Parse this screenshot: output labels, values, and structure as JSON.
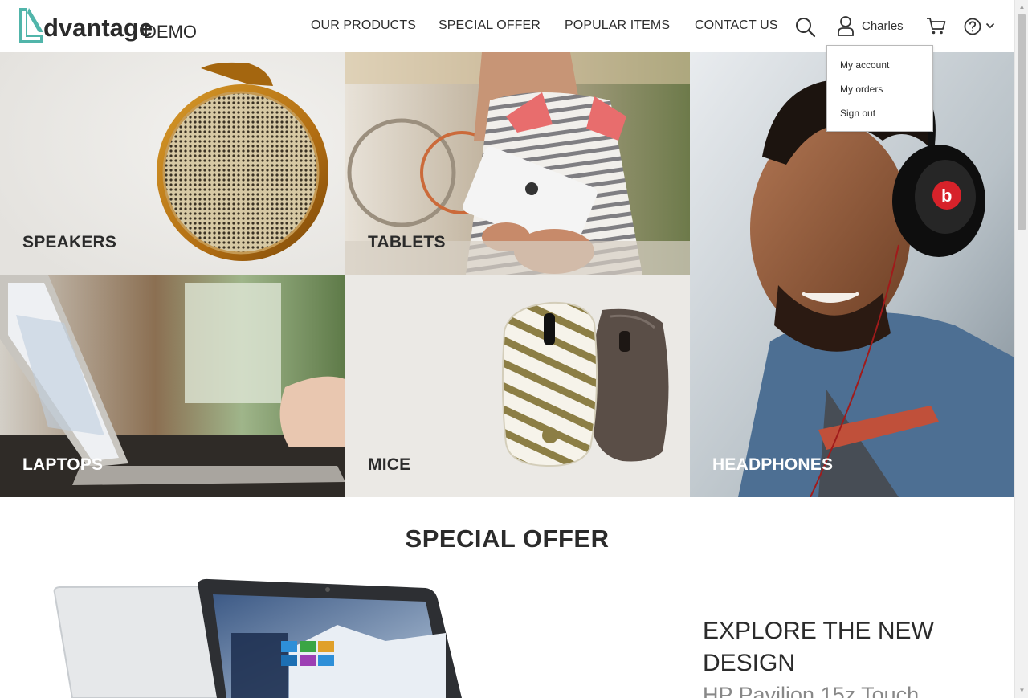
{
  "brand": {
    "name": "dvantage",
    "suffix": "DEMO"
  },
  "colors": {
    "accent": "#51b5aa",
    "text": "#2b2b2b"
  },
  "nav": {
    "items": [
      "OUR PRODUCTS",
      "SPECIAL OFFER",
      "POPULAR ITEMS",
      "CONTACT US"
    ]
  },
  "header": {
    "search_icon": "search-icon",
    "user_icon": "user-icon",
    "user_name": "Charles",
    "cart_icon": "cart-icon",
    "help_icon": "help-icon"
  },
  "user_menu": {
    "items": [
      "My account",
      "My orders",
      "Sign out"
    ]
  },
  "categories": [
    {
      "label": "SPEAKERS"
    },
    {
      "label": "TABLETS"
    },
    {
      "label": "HEADPHONES"
    },
    {
      "label": "LAPTOPS"
    },
    {
      "label": "MICE"
    }
  ],
  "special_offer": {
    "heading": "SPECIAL OFFER",
    "explore": "EXPLORE THE NEW DESIGN",
    "product_name": "HP Pavilion 15z Touch"
  }
}
